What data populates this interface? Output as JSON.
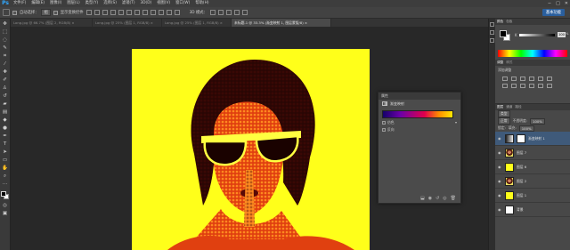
{
  "app": {
    "logo": "Ps"
  },
  "menubar": {
    "items": [
      "文件(F)",
      "编辑(E)",
      "图像(I)",
      "图层(L)",
      "类型(Y)",
      "选择(S)",
      "滤镜(T)",
      "3D(D)",
      "视图(V)",
      "窗口(W)",
      "帮助(H)"
    ]
  },
  "window_controls": {
    "minimize": "−",
    "maximize": "□",
    "close": "✕"
  },
  "options_bar": {
    "auto_select_label": "自动选择：",
    "auto_select_value": "组",
    "transform_label": "显示变换控件",
    "mode3d_label": "3D 模式：",
    "workspace": "基本功能"
  },
  "doc_tabs": [
    {
      "label": "Long.jpg @ 66.7% (图层 2, RGB/8) ×",
      "active": false
    },
    {
      "label": "Long.jpg @ 25% (图层 1, RGB/8) ×",
      "active": false
    },
    {
      "label": "Long.jpg @ 25% (图层 1, RGB/8) ×",
      "active": false
    },
    {
      "label": "未标题-1 @ 33.3% (渐变映射 1, 图层蒙版/8) ×",
      "active": true
    }
  ],
  "properties_panel": {
    "header": "属性",
    "type_label": "渐变映射",
    "gradient_colors": [
      "#14006a",
      "#6b00a8",
      "#e0004c",
      "#ff8a00",
      "#ffe800"
    ],
    "options": [
      "仿色",
      "反向"
    ]
  },
  "right_panels": {
    "color_tabs": [
      "颜色",
      "色板"
    ],
    "k_label": "K",
    "k_value": "100",
    "k_unit": "%",
    "adjust_tabs": [
      "调整",
      "样式"
    ],
    "adjust_title": "添加调整"
  },
  "layers_panel": {
    "tabs": [
      "图层",
      "通道",
      "路径"
    ],
    "filter_label": "类型",
    "blend_mode": "正常",
    "opacity_label": "不透明度:",
    "opacity_value": "100%",
    "lock_label": "锁定:",
    "fill_label": "填充:",
    "fill_value": "100%",
    "layers": [
      {
        "name": "渐变映射 1",
        "thumb": "adjust",
        "selected": true
      },
      {
        "name": "图层 7",
        "thumb": "photo",
        "selected": false
      },
      {
        "name": "图层 6",
        "thumb": "yellow",
        "selected": false
      },
      {
        "name": "图层 2",
        "thumb": "photo",
        "selected": false
      },
      {
        "name": "图层 1",
        "thumb": "yellow",
        "selected": false
      },
      {
        "name": "背景",
        "thumb": "white",
        "selected": false
      }
    ]
  },
  "colors": {
    "canvas_bg": "#ffff1a",
    "ui_dark": "#282828",
    "panel": "#484848",
    "accent": "#2a5f9e"
  }
}
